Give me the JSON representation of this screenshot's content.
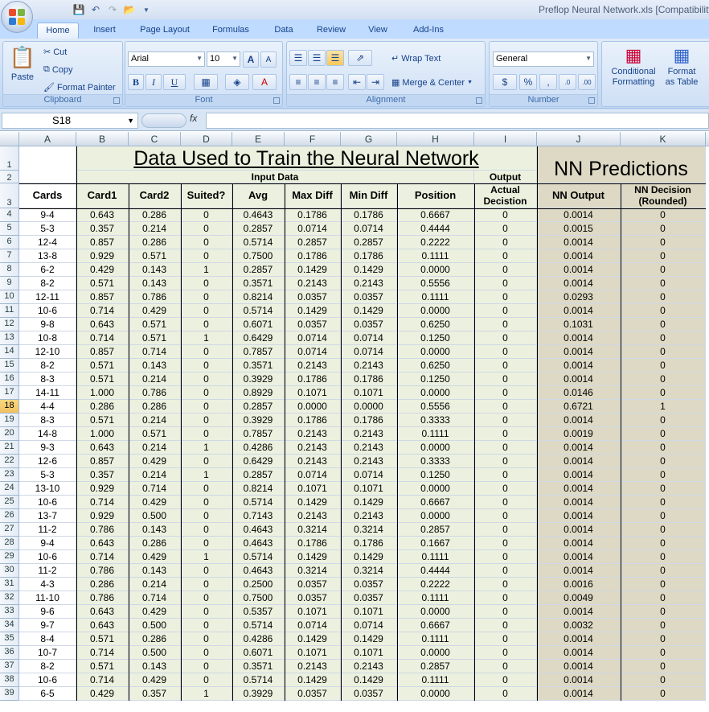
{
  "window": {
    "title": "Preflop Neural Network.xls  [Compatibility"
  },
  "qat": {
    "save_icon": "save-icon",
    "undo_icon": "undo-icon",
    "redo_icon": "redo-icon",
    "open_icon": "open-icon"
  },
  "tabs": [
    "Home",
    "Insert",
    "Page Layout",
    "Formulas",
    "Data",
    "Review",
    "View",
    "Add-Ins"
  ],
  "ribbon": {
    "clipboard": {
      "paste": "Paste",
      "cut": "Cut",
      "copy": "Copy",
      "format_painter": "Format Painter",
      "label": "Clipboard"
    },
    "font": {
      "name": "Arial",
      "size": "10",
      "label": "Font",
      "bold": "B",
      "italic": "I",
      "underline": "U",
      "grow": "A",
      "shrink": "A"
    },
    "alignment": {
      "wrap": "Wrap Text",
      "merge": "Merge & Center",
      "label": "Alignment"
    },
    "number": {
      "format": "General",
      "currency": "$",
      "percent": "%",
      "comma": ",",
      "inc_decimal": ".0",
      "dec_decimal": ".00",
      "label": "Number"
    },
    "styles": {
      "conditional": "Conditional",
      "conditional2": "Formatting",
      "format_table": "Format",
      "format_table2": "as Table"
    }
  },
  "formula_bar": {
    "name_box": "S18",
    "fx": "fx",
    "value": ""
  },
  "columns": [
    "A",
    "B",
    "C",
    "D",
    "E",
    "F",
    "G",
    "H",
    "I",
    "J",
    "K"
  ],
  "selected_row": 18,
  "sheet": {
    "title": "Data Used to Train the Neural Network",
    "nn_title": "NN Predictions",
    "input_data": "Input Data",
    "output": "Output",
    "headers": [
      "Cards",
      "Card1",
      "Card2",
      "Suited?",
      "Avg",
      "Max Diff",
      "Min Diff",
      "Position",
      "Actual Decistion",
      "NN Output",
      "NN Decision (Rounded)"
    ],
    "rows": [
      [
        "9-4",
        "0.643",
        "0.286",
        "0",
        "0.4643",
        "0.1786",
        "0.1786",
        "0.6667",
        "0",
        "0.0014",
        "0"
      ],
      [
        "5-3",
        "0.357",
        "0.214",
        "0",
        "0.2857",
        "0.0714",
        "0.0714",
        "0.4444",
        "0",
        "0.0015",
        "0"
      ],
      [
        "12-4",
        "0.857",
        "0.286",
        "0",
        "0.5714",
        "0.2857",
        "0.2857",
        "0.2222",
        "0",
        "0.0014",
        "0"
      ],
      [
        "13-8",
        "0.929",
        "0.571",
        "0",
        "0.7500",
        "0.1786",
        "0.1786",
        "0.1111",
        "0",
        "0.0014",
        "0"
      ],
      [
        "6-2",
        "0.429",
        "0.143",
        "1",
        "0.2857",
        "0.1429",
        "0.1429",
        "0.0000",
        "0",
        "0.0014",
        "0"
      ],
      [
        "8-2",
        "0.571",
        "0.143",
        "0",
        "0.3571",
        "0.2143",
        "0.2143",
        "0.5556",
        "0",
        "0.0014",
        "0"
      ],
      [
        "12-11",
        "0.857",
        "0.786",
        "0",
        "0.8214",
        "0.0357",
        "0.0357",
        "0.1111",
        "0",
        "0.0293",
        "0"
      ],
      [
        "10-6",
        "0.714",
        "0.429",
        "0",
        "0.5714",
        "0.1429",
        "0.1429",
        "0.0000",
        "0",
        "0.0014",
        "0"
      ],
      [
        "9-8",
        "0.643",
        "0.571",
        "0",
        "0.6071",
        "0.0357",
        "0.0357",
        "0.6250",
        "0",
        "0.1031",
        "0"
      ],
      [
        "10-8",
        "0.714",
        "0.571",
        "1",
        "0.6429",
        "0.0714",
        "0.0714",
        "0.1250",
        "0",
        "0.0014",
        "0"
      ],
      [
        "12-10",
        "0.857",
        "0.714",
        "0",
        "0.7857",
        "0.0714",
        "0.0714",
        "0.0000",
        "0",
        "0.0014",
        "0"
      ],
      [
        "8-2",
        "0.571",
        "0.143",
        "0",
        "0.3571",
        "0.2143",
        "0.2143",
        "0.6250",
        "0",
        "0.0014",
        "0"
      ],
      [
        "8-3",
        "0.571",
        "0.214",
        "0",
        "0.3929",
        "0.1786",
        "0.1786",
        "0.1250",
        "0",
        "0.0014",
        "0"
      ],
      [
        "14-11",
        "1.000",
        "0.786",
        "0",
        "0.8929",
        "0.1071",
        "0.1071",
        "0.0000",
        "0",
        "0.0146",
        "0"
      ],
      [
        "4-4",
        "0.286",
        "0.286",
        "0",
        "0.2857",
        "0.0000",
        "0.0000",
        "0.5556",
        "0",
        "0.6721",
        "1"
      ],
      [
        "8-3",
        "0.571",
        "0.214",
        "0",
        "0.3929",
        "0.1786",
        "0.1786",
        "0.3333",
        "0",
        "0.0014",
        "0"
      ],
      [
        "14-8",
        "1.000",
        "0.571",
        "0",
        "0.7857",
        "0.2143",
        "0.2143",
        "0.1111",
        "0",
        "0.0019",
        "0"
      ],
      [
        "9-3",
        "0.643",
        "0.214",
        "1",
        "0.4286",
        "0.2143",
        "0.2143",
        "0.0000",
        "0",
        "0.0014",
        "0"
      ],
      [
        "12-6",
        "0.857",
        "0.429",
        "0",
        "0.6429",
        "0.2143",
        "0.2143",
        "0.3333",
        "0",
        "0.0014",
        "0"
      ],
      [
        "5-3",
        "0.357",
        "0.214",
        "1",
        "0.2857",
        "0.0714",
        "0.0714",
        "0.1250",
        "0",
        "0.0014",
        "0"
      ],
      [
        "13-10",
        "0.929",
        "0.714",
        "0",
        "0.8214",
        "0.1071",
        "0.1071",
        "0.0000",
        "0",
        "0.0014",
        "0"
      ],
      [
        "10-6",
        "0.714",
        "0.429",
        "0",
        "0.5714",
        "0.1429",
        "0.1429",
        "0.6667",
        "0",
        "0.0014",
        "0"
      ],
      [
        "13-7",
        "0.929",
        "0.500",
        "0",
        "0.7143",
        "0.2143",
        "0.2143",
        "0.0000",
        "0",
        "0.0014",
        "0"
      ],
      [
        "11-2",
        "0.786",
        "0.143",
        "0",
        "0.4643",
        "0.3214",
        "0.3214",
        "0.2857",
        "0",
        "0.0014",
        "0"
      ],
      [
        "9-4",
        "0.643",
        "0.286",
        "0",
        "0.4643",
        "0.1786",
        "0.1786",
        "0.1667",
        "0",
        "0.0014",
        "0"
      ],
      [
        "10-6",
        "0.714",
        "0.429",
        "1",
        "0.5714",
        "0.1429",
        "0.1429",
        "0.1111",
        "0",
        "0.0014",
        "0"
      ],
      [
        "11-2",
        "0.786",
        "0.143",
        "0",
        "0.4643",
        "0.3214",
        "0.3214",
        "0.4444",
        "0",
        "0.0014",
        "0"
      ],
      [
        "4-3",
        "0.286",
        "0.214",
        "0",
        "0.2500",
        "0.0357",
        "0.0357",
        "0.2222",
        "0",
        "0.0016",
        "0"
      ],
      [
        "11-10",
        "0.786",
        "0.714",
        "0",
        "0.7500",
        "0.0357",
        "0.0357",
        "0.1111",
        "0",
        "0.0049",
        "0"
      ],
      [
        "9-6",
        "0.643",
        "0.429",
        "0",
        "0.5357",
        "0.1071",
        "0.1071",
        "0.0000",
        "0",
        "0.0014",
        "0"
      ],
      [
        "9-7",
        "0.643",
        "0.500",
        "0",
        "0.5714",
        "0.0714",
        "0.0714",
        "0.6667",
        "0",
        "0.0032",
        "0"
      ],
      [
        "8-4",
        "0.571",
        "0.286",
        "0",
        "0.4286",
        "0.1429",
        "0.1429",
        "0.1111",
        "0",
        "0.0014",
        "0"
      ],
      [
        "10-7",
        "0.714",
        "0.500",
        "0",
        "0.6071",
        "0.1071",
        "0.1071",
        "0.0000",
        "0",
        "0.0014",
        "0"
      ],
      [
        "8-2",
        "0.571",
        "0.143",
        "0",
        "0.3571",
        "0.2143",
        "0.2143",
        "0.2857",
        "0",
        "0.0014",
        "0"
      ],
      [
        "10-6",
        "0.714",
        "0.429",
        "0",
        "0.5714",
        "0.1429",
        "0.1429",
        "0.1111",
        "0",
        "0.0014",
        "0"
      ],
      [
        "6-5",
        "0.429",
        "0.357",
        "1",
        "0.3929",
        "0.0357",
        "0.0357",
        "0.0000",
        "0",
        "0.0014",
        "0"
      ]
    ]
  }
}
